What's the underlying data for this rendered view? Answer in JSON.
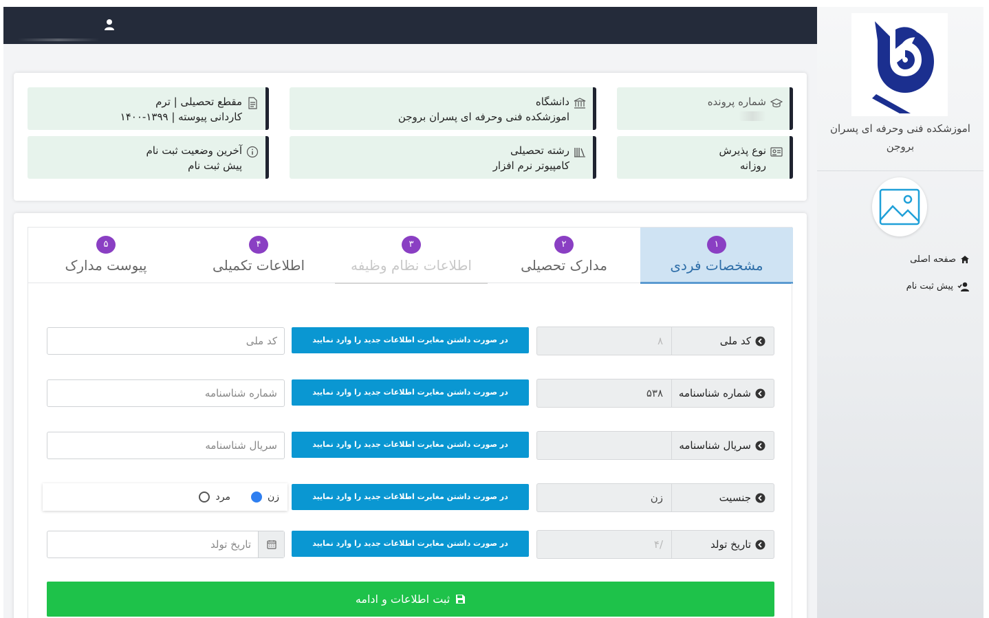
{
  "sidebar": {
    "school_name": "اموزشکده فنی وحرفه ای پسران بروجن",
    "menu": [
      {
        "label": "صفحه اصلی",
        "icon": "home-icon"
      },
      {
        "label": "پیش ثبت نام",
        "icon": "user-check-icon"
      }
    ]
  },
  "info": {
    "file_number_label": "شماره پرونده",
    "university_label": "دانشگاه",
    "university_value": "اموزشکده فنی وحرفه ای پسران بروجن",
    "level_label": "مقطع تحصیلی | ترم",
    "level_value": "کاردانی پیوسته | ۱۳۹۹-۱۴۰۰",
    "admission_label": "نوع پذیرش",
    "admission_value": "روزانه",
    "field_label": "رشته تحصیلی",
    "field_value": "کامپیوتر نرم افزار",
    "status_label": "آخرین وضعیت ثبت نام",
    "status_value": "پیش ثبت نام"
  },
  "tabs": [
    {
      "num": "۱",
      "label": "مشخصات فردی"
    },
    {
      "num": "۲",
      "label": "مدارک تحصیلی"
    },
    {
      "num": "۳",
      "label": "اطلاعات نظام وظیفه"
    },
    {
      "num": "۴",
      "label": "اطلاعات تکمیلی"
    },
    {
      "num": "۵",
      "label": "پیوست مدارک"
    }
  ],
  "form": {
    "notice": "در صورت داشتن مغایرت اطلاعات جدید را وارد نمایید",
    "national_code": {
      "label": "کد ملی",
      "value": "۸",
      "placeholder": "کد ملی"
    },
    "id_number": {
      "label": "شماره شناسنامه",
      "value": "۵۳۸",
      "placeholder": "شماره شناسنامه"
    },
    "id_serial": {
      "label": "سریال شناسنامه",
      "value": "",
      "placeholder": "سریال شناسنامه"
    },
    "gender": {
      "label": "جنسیت",
      "value": "زن",
      "options": [
        "زن",
        "مرد"
      ],
      "selected": "زن"
    },
    "birth_date": {
      "label": "تاریخ تولد",
      "value": "/۴",
      "placeholder": "تاریخ تولد"
    },
    "submit_label": "ثبت اطلاعات و ادامه"
  }
}
